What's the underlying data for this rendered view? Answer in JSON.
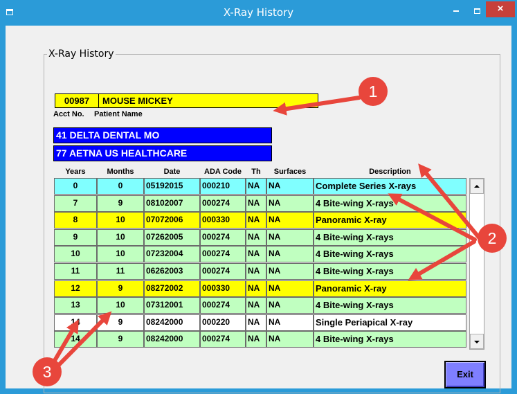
{
  "window": {
    "title": "X-Ray History",
    "close_glyph": "×"
  },
  "groupbox": {
    "label": "X-Ray History"
  },
  "patient": {
    "acct_no": "00987",
    "name": "MOUSE MICKEY",
    "acct_label": "Acct No.",
    "name_label": "Patient Name"
  },
  "insurance": [
    "41 DELTA DENTAL MO",
    "77 AETNA US HEALTHCARE"
  ],
  "table": {
    "headers": [
      "Years",
      "Months",
      "Date",
      "ADA Code",
      "Th",
      "Surfaces",
      "Description"
    ],
    "rows": [
      {
        "years": "0",
        "months": "0",
        "date": "05192015",
        "ada": "000210",
        "th": "NA",
        "surfaces": "NA",
        "description": "Complete Series X-rays",
        "color": "#80ffff"
      },
      {
        "years": "7",
        "months": "9",
        "date": "08102007",
        "ada": "000274",
        "th": "NA",
        "surfaces": "NA",
        "description": "4 Bite-wing X-rays",
        "color": "#c0ffc0"
      },
      {
        "years": "8",
        "months": "10",
        "date": "07072006",
        "ada": "000330",
        "th": "NA",
        "surfaces": "NA",
        "description": "Panoramic X-ray",
        "color": "#ffff00"
      },
      {
        "years": "9",
        "months": "10",
        "date": "07262005",
        "ada": "000274",
        "th": "NA",
        "surfaces": "NA",
        "description": "4 Bite-wing X-rays",
        "color": "#c0ffc0"
      },
      {
        "years": "10",
        "months": "10",
        "date": "07232004",
        "ada": "000274",
        "th": "NA",
        "surfaces": "NA",
        "description": "4 Bite-wing X-rays",
        "color": "#c0ffc0"
      },
      {
        "years": "11",
        "months": "11",
        "date": "06262003",
        "ada": "000274",
        "th": "NA",
        "surfaces": "NA",
        "description": "4 Bite-wing X-rays",
        "color": "#c0ffc0"
      },
      {
        "years": "12",
        "months": "9",
        "date": "08272002",
        "ada": "000330",
        "th": "NA",
        "surfaces": "NA",
        "description": "Panoramic X-ray",
        "color": "#ffff00"
      },
      {
        "years": "13",
        "months": "10",
        "date": "07312001",
        "ada": "000274",
        "th": "NA",
        "surfaces": "NA",
        "description": "4 Bite-wing X-rays",
        "color": "#c0ffc0"
      },
      {
        "years": "14",
        "months": "9",
        "date": "08242000",
        "ada": "000220",
        "th": "NA",
        "surfaces": "NA",
        "description": "Single Periapical X-ray",
        "color": "#ffffff"
      },
      {
        "years": "14",
        "months": "9",
        "date": "08242000",
        "ada": "000274",
        "th": "NA",
        "surfaces": "NA",
        "description": "4 Bite-wing X-rays",
        "color": "#c0ffc0"
      }
    ]
  },
  "buttons": {
    "exit": "Exit"
  },
  "callouts": [
    "1",
    "2",
    "3"
  ],
  "colors": {
    "titlebar": "#2b9bd8",
    "close_button": "#c7403a",
    "patient_field": "#ffff00",
    "insurance_field": "#0000ff",
    "exit_button": "#7f7fff",
    "annotation": "#e8463c"
  }
}
